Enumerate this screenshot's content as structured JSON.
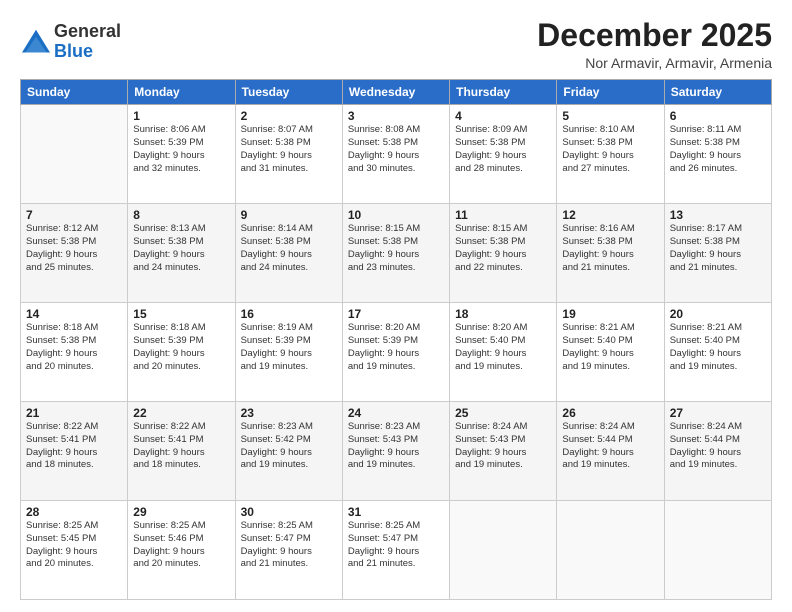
{
  "header": {
    "logo": {
      "line1": "General",
      "line2": "Blue"
    },
    "title": "December 2025",
    "location": "Nor Armavir, Armavir, Armenia"
  },
  "days_of_week": [
    "Sunday",
    "Monday",
    "Tuesday",
    "Wednesday",
    "Thursday",
    "Friday",
    "Saturday"
  ],
  "weeks": [
    [
      {
        "day": "",
        "info": ""
      },
      {
        "day": "1",
        "info": "Sunrise: 8:06 AM\nSunset: 5:39 PM\nDaylight: 9 hours\nand 32 minutes."
      },
      {
        "day": "2",
        "info": "Sunrise: 8:07 AM\nSunset: 5:38 PM\nDaylight: 9 hours\nand 31 minutes."
      },
      {
        "day": "3",
        "info": "Sunrise: 8:08 AM\nSunset: 5:38 PM\nDaylight: 9 hours\nand 30 minutes."
      },
      {
        "day": "4",
        "info": "Sunrise: 8:09 AM\nSunset: 5:38 PM\nDaylight: 9 hours\nand 28 minutes."
      },
      {
        "day": "5",
        "info": "Sunrise: 8:10 AM\nSunset: 5:38 PM\nDaylight: 9 hours\nand 27 minutes."
      },
      {
        "day": "6",
        "info": "Sunrise: 8:11 AM\nSunset: 5:38 PM\nDaylight: 9 hours\nand 26 minutes."
      }
    ],
    [
      {
        "day": "7",
        "info": "Sunrise: 8:12 AM\nSunset: 5:38 PM\nDaylight: 9 hours\nand 25 minutes."
      },
      {
        "day": "8",
        "info": "Sunrise: 8:13 AM\nSunset: 5:38 PM\nDaylight: 9 hours\nand 24 minutes."
      },
      {
        "day": "9",
        "info": "Sunrise: 8:14 AM\nSunset: 5:38 PM\nDaylight: 9 hours\nand 24 minutes."
      },
      {
        "day": "10",
        "info": "Sunrise: 8:15 AM\nSunset: 5:38 PM\nDaylight: 9 hours\nand 23 minutes."
      },
      {
        "day": "11",
        "info": "Sunrise: 8:15 AM\nSunset: 5:38 PM\nDaylight: 9 hours\nand 22 minutes."
      },
      {
        "day": "12",
        "info": "Sunrise: 8:16 AM\nSunset: 5:38 PM\nDaylight: 9 hours\nand 21 minutes."
      },
      {
        "day": "13",
        "info": "Sunrise: 8:17 AM\nSunset: 5:38 PM\nDaylight: 9 hours\nand 21 minutes."
      }
    ],
    [
      {
        "day": "14",
        "info": "Sunrise: 8:18 AM\nSunset: 5:38 PM\nDaylight: 9 hours\nand 20 minutes."
      },
      {
        "day": "15",
        "info": "Sunrise: 8:18 AM\nSunset: 5:39 PM\nDaylight: 9 hours\nand 20 minutes."
      },
      {
        "day": "16",
        "info": "Sunrise: 8:19 AM\nSunset: 5:39 PM\nDaylight: 9 hours\nand 19 minutes."
      },
      {
        "day": "17",
        "info": "Sunrise: 8:20 AM\nSunset: 5:39 PM\nDaylight: 9 hours\nand 19 minutes."
      },
      {
        "day": "18",
        "info": "Sunrise: 8:20 AM\nSunset: 5:40 PM\nDaylight: 9 hours\nand 19 minutes."
      },
      {
        "day": "19",
        "info": "Sunrise: 8:21 AM\nSunset: 5:40 PM\nDaylight: 9 hours\nand 19 minutes."
      },
      {
        "day": "20",
        "info": "Sunrise: 8:21 AM\nSunset: 5:40 PM\nDaylight: 9 hours\nand 19 minutes."
      }
    ],
    [
      {
        "day": "21",
        "info": "Sunrise: 8:22 AM\nSunset: 5:41 PM\nDaylight: 9 hours\nand 18 minutes."
      },
      {
        "day": "22",
        "info": "Sunrise: 8:22 AM\nSunset: 5:41 PM\nDaylight: 9 hours\nand 18 minutes."
      },
      {
        "day": "23",
        "info": "Sunrise: 8:23 AM\nSunset: 5:42 PM\nDaylight: 9 hours\nand 19 minutes."
      },
      {
        "day": "24",
        "info": "Sunrise: 8:23 AM\nSunset: 5:43 PM\nDaylight: 9 hours\nand 19 minutes."
      },
      {
        "day": "25",
        "info": "Sunrise: 8:24 AM\nSunset: 5:43 PM\nDaylight: 9 hours\nand 19 minutes."
      },
      {
        "day": "26",
        "info": "Sunrise: 8:24 AM\nSunset: 5:44 PM\nDaylight: 9 hours\nand 19 minutes."
      },
      {
        "day": "27",
        "info": "Sunrise: 8:24 AM\nSunset: 5:44 PM\nDaylight: 9 hours\nand 19 minutes."
      }
    ],
    [
      {
        "day": "28",
        "info": "Sunrise: 8:25 AM\nSunset: 5:45 PM\nDaylight: 9 hours\nand 20 minutes."
      },
      {
        "day": "29",
        "info": "Sunrise: 8:25 AM\nSunset: 5:46 PM\nDaylight: 9 hours\nand 20 minutes."
      },
      {
        "day": "30",
        "info": "Sunrise: 8:25 AM\nSunset: 5:47 PM\nDaylight: 9 hours\nand 21 minutes."
      },
      {
        "day": "31",
        "info": "Sunrise: 8:25 AM\nSunset: 5:47 PM\nDaylight: 9 hours\nand 21 minutes."
      },
      {
        "day": "",
        "info": ""
      },
      {
        "day": "",
        "info": ""
      },
      {
        "day": "",
        "info": ""
      }
    ]
  ]
}
